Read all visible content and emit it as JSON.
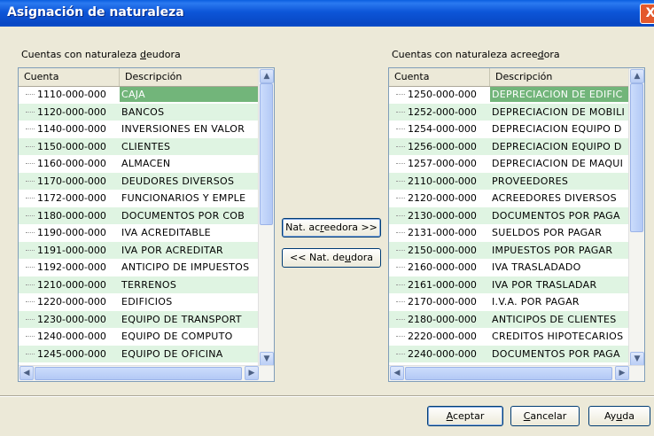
{
  "window": {
    "title": "Asignación de naturaleza",
    "close_glyph": "X"
  },
  "left": {
    "label_pre": "Cuentas con naturaleza ",
    "label_acc": "d",
    "label_post": "eudora",
    "col_cuenta": "Cuenta",
    "col_desc": "Descripción",
    "rows": [
      {
        "code": "1110-000-000",
        "desc": "CAJA"
      },
      {
        "code": "1120-000-000",
        "desc": "BANCOS"
      },
      {
        "code": "1140-000-000",
        "desc": "INVERSIONES EN VALOR"
      },
      {
        "code": "1150-000-000",
        "desc": "CLIENTES"
      },
      {
        "code": "1160-000-000",
        "desc": "ALMACEN"
      },
      {
        "code": "1170-000-000",
        "desc": "DEUDORES DIVERSOS"
      },
      {
        "code": "1172-000-000",
        "desc": "FUNCIONARIOS Y EMPLE"
      },
      {
        "code": "1180-000-000",
        "desc": "DOCUMENTOS POR COB"
      },
      {
        "code": "1190-000-000",
        "desc": "IVA ACREDITABLE"
      },
      {
        "code": "1191-000-000",
        "desc": "IVA POR ACREDITAR"
      },
      {
        "code": "1192-000-000",
        "desc": "ANTICIPO DE IMPUESTOS"
      },
      {
        "code": "1210-000-000",
        "desc": "TERRENOS"
      },
      {
        "code": "1220-000-000",
        "desc": "EDIFICIOS"
      },
      {
        "code": "1230-000-000",
        "desc": "EQUIPO DE TRANSPORT"
      },
      {
        "code": "1240-000-000",
        "desc": "EQUIPO DE COMPUTO"
      },
      {
        "code": "1245-000-000",
        "desc": "EQUIPO DE OFICINA"
      }
    ]
  },
  "right": {
    "label_pre": "Cuentas con naturaleza acree",
    "label_acc": "d",
    "label_post": "ora",
    "col_cuenta": "Cuenta",
    "col_desc": "Descripción",
    "rows": [
      {
        "code": "1250-000-000",
        "desc": "DEPRECIACION DE EDIFIC"
      },
      {
        "code": "1252-000-000",
        "desc": "DEPRECIACION DE MOBILI"
      },
      {
        "code": "1254-000-000",
        "desc": "DEPRECIACION EQUIPO D"
      },
      {
        "code": "1256-000-000",
        "desc": "DEPRECIACION EQUIPO D"
      },
      {
        "code": "1257-000-000",
        "desc": "DEPRECIACION DE MAQUI"
      },
      {
        "code": "2110-000-000",
        "desc": "PROVEEDORES"
      },
      {
        "code": "2120-000-000",
        "desc": "ACREEDORES DIVERSOS"
      },
      {
        "code": "2130-000-000",
        "desc": "DOCUMENTOS POR PAGA"
      },
      {
        "code": "2131-000-000",
        "desc": "SUELDOS POR PAGAR"
      },
      {
        "code": "2150-000-000",
        "desc": "IMPUESTOS POR PAGAR"
      },
      {
        "code": "2160-000-000",
        "desc": "IVA TRASLADADO"
      },
      {
        "code": "2161-000-000",
        "desc": "IVA POR TRASLADAR"
      },
      {
        "code": "2170-000-000",
        "desc": "I.V.A. POR PAGAR"
      },
      {
        "code": "2180-000-000",
        "desc": "ANTICIPOS DE CLIENTES"
      },
      {
        "code": "2220-000-000",
        "desc": "CREDITOS HIPOTECARIOS"
      },
      {
        "code": "2240-000-000",
        "desc": "DOCUMENTOS POR PAGA"
      }
    ]
  },
  "middle": {
    "to_acreedora_pre": "Nat. ac",
    "to_acreedora_acc": "r",
    "to_acreedora_post": "eedora >>",
    "to_deudora_pre": "<< Nat. de",
    "to_deudora_acc": "u",
    "to_deudora_post": "dora"
  },
  "footer": {
    "accept_acc": "A",
    "accept_post": "ceptar",
    "cancel_acc": "C",
    "cancel_post": "ancelar",
    "help_pre": "Ay",
    "help_acc": "u",
    "help_post": "da"
  },
  "scroll": {
    "up": "▲",
    "down": "▼",
    "left": "◀",
    "right": "▶"
  }
}
